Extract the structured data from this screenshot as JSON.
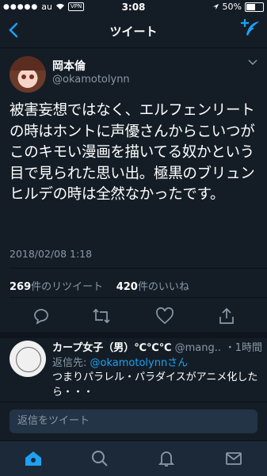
{
  "status_bar": {
    "carrier": "au",
    "vpn": "VPN",
    "time": "3:08",
    "battery": "50%",
    "battery_level_percent": 50
  },
  "nav": {
    "title": "ツイート",
    "back_icon": "chevron-left-icon",
    "compose_icon": "compose-quill-icon"
  },
  "tweet": {
    "display_name": "岡本倫",
    "handle": "@okamotolynn",
    "text": "被害妄想ではなく、エルフェンリートの時はホントに声優さんからこいつがこのキモい漫画を描いてる奴かという目で見られた思い出。極黒のブリュンヒルデの時は全然なかったです。",
    "timestamp": "2018/02/08 1:18",
    "retweets_count": "269",
    "retweets_label": "件のリツイート",
    "likes_count": "420",
    "likes_label": "件のいいね"
  },
  "reply": {
    "display_name": "カープ女子（男）℃℃℃",
    "handle": "@mang...",
    "time": "・1時間",
    "reply_to_label": "返信先: ",
    "reply_to_handle": "@okamotolynnさん",
    "text": "つまりパラレル・パラダイスがアニメ化したら・・・"
  },
  "composer": {
    "placeholder": "返信をツイート"
  },
  "tabbar": {
    "active_tab": "home",
    "tabs": [
      "home",
      "search",
      "notifications",
      "messages"
    ]
  },
  "colors": {
    "background": "#141d26",
    "accent": "#1da1f2",
    "secondary_text": "#8899a6"
  }
}
